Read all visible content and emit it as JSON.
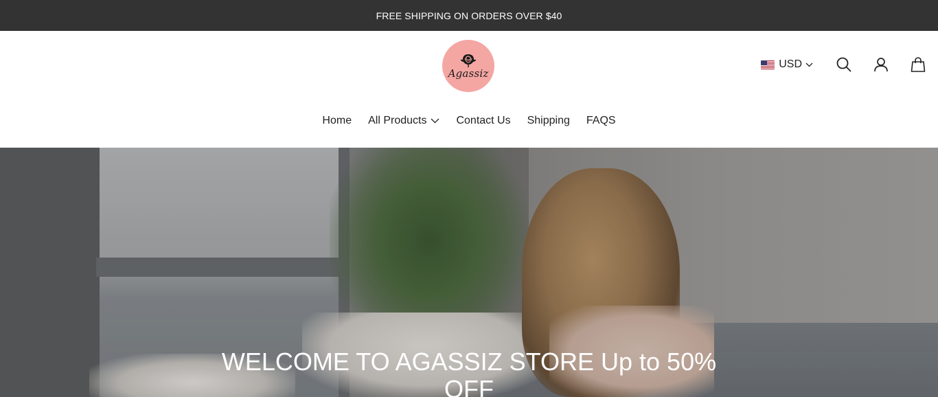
{
  "announcement": "FREE SHIPPING ON ORDERS OVER $40",
  "logo": {
    "text": "Agassiz",
    "icon": "rose-icon",
    "bg_color": "#f4a6a3"
  },
  "currency": {
    "code": "USD",
    "flag": "us-flag-icon"
  },
  "icons": {
    "search": "search-icon",
    "account": "user-icon",
    "cart": "bag-icon"
  },
  "nav": {
    "items": [
      {
        "label": "Home"
      },
      {
        "label": "All Products"
      },
      {
        "label": "Contact Us"
      },
      {
        "label": "Shipping"
      },
      {
        "label": "FAQS"
      }
    ]
  },
  "hero": {
    "title": "WELCOME TO AGASSIZ STORE Up to 50% OFF"
  },
  "colors": {
    "announcement_bg": "#333333",
    "text": "#222222",
    "hero_text": "#ffffff"
  }
}
